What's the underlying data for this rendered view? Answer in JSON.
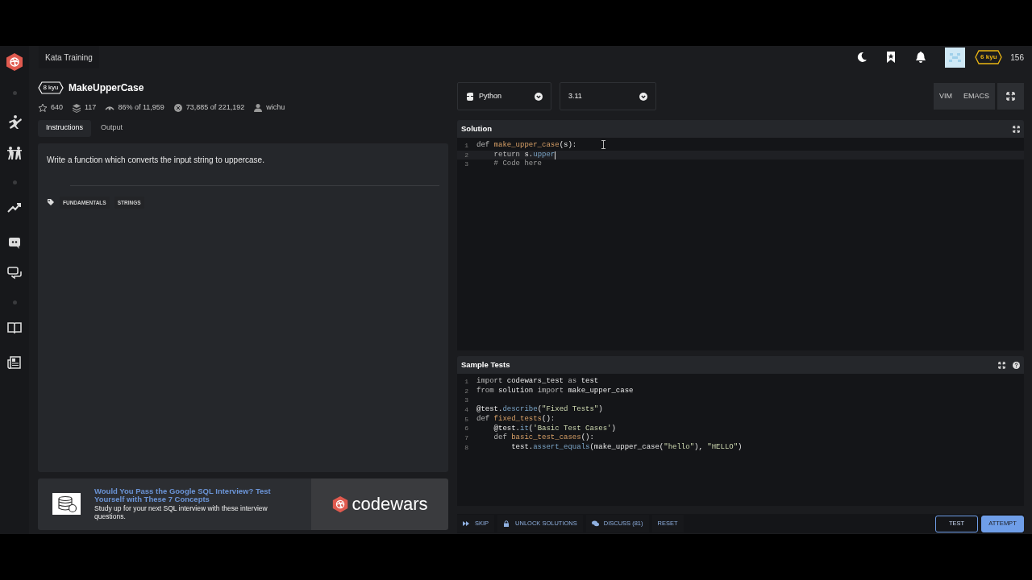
{
  "top_bar": {
    "section_tab": "Kata Training",
    "rank_badge": "6 kyu",
    "honor": "156"
  },
  "kata": {
    "rank": "8 kyu",
    "title": "MakeUpperCase",
    "stats": [
      {
        "kind": "star",
        "text": "640"
      },
      {
        "kind": "stack",
        "text": "117"
      },
      {
        "kind": "eye",
        "text": "86% of 11,959"
      },
      {
        "kind": "circle",
        "text": "73,885 of 221,192"
      },
      {
        "kind": "user",
        "text": "wichu"
      }
    ],
    "tabs": [
      {
        "label": "Instructions",
        "selected": true
      },
      {
        "label": "Output",
        "selected": false
      }
    ],
    "description": "Write a function which converts the input string to uppercase.",
    "tags": [
      "FUNDAMENTALS",
      "STRINGS"
    ]
  },
  "ad": {
    "title": "Would You Pass the Google SQL Interview? Test Yourself with These 7 Concepts",
    "body": "Study up for your next SQL interview with these interview questions.",
    "brand": "codewars"
  },
  "editor_controls": {
    "language": "Python",
    "version": "3.11",
    "modes": [
      "VIM",
      "EMACS"
    ]
  },
  "solution": {
    "title": "Solution",
    "lines": [
      {
        "n": "1",
        "current": false,
        "tokens": [
          {
            "t": "def ",
            "kind": "kw"
          },
          {
            "t": "make_upper_case",
            "kind": "fn"
          },
          {
            "t": "(s):",
            "kind": "plain"
          }
        ]
      },
      {
        "n": "2",
        "current": true,
        "tokens": [
          {
            "t": "    return ",
            "kind": "kw"
          },
          {
            "t": "s.",
            "kind": "plain"
          },
          {
            "t": "upper",
            "kind": "attr"
          }
        ]
      },
      {
        "n": "3",
        "current": false,
        "tokens": [
          {
            "t": "    # Code here",
            "kind": "comment"
          }
        ]
      }
    ]
  },
  "sample_tests": {
    "title": "Sample Tests",
    "lines": [
      {
        "n": "1",
        "current": false,
        "tokens": [
          {
            "t": "import ",
            "kind": "kw"
          },
          {
            "t": "codewars_test ",
            "kind": "plain"
          },
          {
            "t": "as ",
            "kind": "kw"
          },
          {
            "t": "test",
            "kind": "plain"
          }
        ]
      },
      {
        "n": "2",
        "current": false,
        "tokens": [
          {
            "t": "from ",
            "kind": "kw"
          },
          {
            "t": "solution ",
            "kind": "plain"
          },
          {
            "t": "import ",
            "kind": "kw"
          },
          {
            "t": "make_upper_case",
            "kind": "plain"
          }
        ]
      },
      {
        "n": "3",
        "current": false
      },
      {
        "n": "4",
        "current": false,
        "tokens": [
          {
            "t": "@test.",
            "kind": "plain"
          },
          {
            "t": "describe",
            "kind": "attr"
          },
          {
            "t": "(",
            "kind": "plain"
          },
          {
            "t": "\"Fixed Tests\"",
            "kind": "str"
          },
          {
            "t": ")",
            "kind": "plain"
          }
        ]
      },
      {
        "n": "5",
        "current": false,
        "tokens": [
          {
            "t": "def ",
            "kind": "kw"
          },
          {
            "t": "fixed_tests",
            "kind": "fn"
          },
          {
            "t": "():",
            "kind": "plain"
          }
        ]
      },
      {
        "n": "6",
        "current": false,
        "tokens": [
          {
            "t": "    @test.",
            "kind": "plain"
          },
          {
            "t": "it",
            "kind": "attr"
          },
          {
            "t": "(",
            "kind": "plain"
          },
          {
            "t": "'Basic Test Cases'",
            "kind": "str"
          },
          {
            "t": ")",
            "kind": "plain"
          }
        ]
      },
      {
        "n": "7",
        "current": false,
        "tokens": [
          {
            "t": "    def ",
            "kind": "kw"
          },
          {
            "t": "basic_test_cases",
            "kind": "fn"
          },
          {
            "t": "():",
            "kind": "plain"
          }
        ]
      },
      {
        "n": "8",
        "current": false,
        "tokens": [
          {
            "t": "        test.",
            "kind": "plain"
          },
          {
            "t": "assert_equals",
            "kind": "attr"
          },
          {
            "t": "(make_upper_case(",
            "kind": "plain"
          },
          {
            "t": "\"hello\"",
            "kind": "str"
          },
          {
            "t": "), ",
            "kind": "plain"
          },
          {
            "t": "\"HELLO\"",
            "kind": "str"
          },
          {
            "t": ")",
            "kind": "plain"
          }
        ]
      }
    ]
  },
  "bottom_bar": {
    "actions": [
      {
        "kind": "skip",
        "label": "SKIP"
      },
      {
        "kind": "lock",
        "label": "UNLOCK SOLUTIONS"
      },
      {
        "kind": "discuss",
        "label": "DISCUSS (81)"
      },
      {
        "kind": "plain",
        "label": "RESET"
      }
    ],
    "buttons": [
      {
        "label": "TEST",
        "primary": false
      },
      {
        "label": "ATTEMPT",
        "primary": true
      }
    ]
  }
}
